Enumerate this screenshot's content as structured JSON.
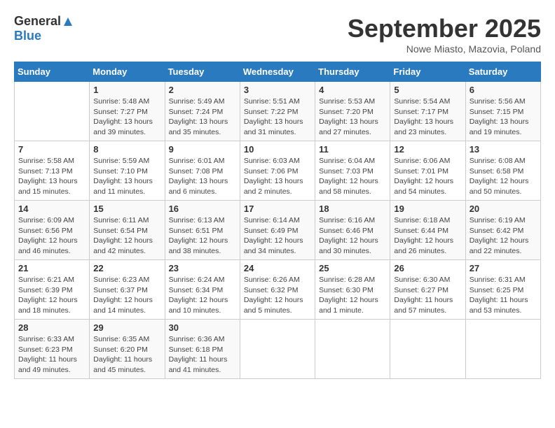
{
  "header": {
    "logo_line1": "General",
    "logo_line2": "Blue",
    "month_title": "September 2025",
    "location": "Nowe Miasto, Mazovia, Poland"
  },
  "weekdays": [
    "Sunday",
    "Monday",
    "Tuesday",
    "Wednesday",
    "Thursday",
    "Friday",
    "Saturday"
  ],
  "weeks": [
    [
      {
        "day": "",
        "info": ""
      },
      {
        "day": "1",
        "info": "Sunrise: 5:48 AM\nSunset: 7:27 PM\nDaylight: 13 hours\nand 39 minutes."
      },
      {
        "day": "2",
        "info": "Sunrise: 5:49 AM\nSunset: 7:24 PM\nDaylight: 13 hours\nand 35 minutes."
      },
      {
        "day": "3",
        "info": "Sunrise: 5:51 AM\nSunset: 7:22 PM\nDaylight: 13 hours\nand 31 minutes."
      },
      {
        "day": "4",
        "info": "Sunrise: 5:53 AM\nSunset: 7:20 PM\nDaylight: 13 hours\nand 27 minutes."
      },
      {
        "day": "5",
        "info": "Sunrise: 5:54 AM\nSunset: 7:17 PM\nDaylight: 13 hours\nand 23 minutes."
      },
      {
        "day": "6",
        "info": "Sunrise: 5:56 AM\nSunset: 7:15 PM\nDaylight: 13 hours\nand 19 minutes."
      }
    ],
    [
      {
        "day": "7",
        "info": "Sunrise: 5:58 AM\nSunset: 7:13 PM\nDaylight: 13 hours\nand 15 minutes."
      },
      {
        "day": "8",
        "info": "Sunrise: 5:59 AM\nSunset: 7:10 PM\nDaylight: 13 hours\nand 11 minutes."
      },
      {
        "day": "9",
        "info": "Sunrise: 6:01 AM\nSunset: 7:08 PM\nDaylight: 13 hours\nand 6 minutes."
      },
      {
        "day": "10",
        "info": "Sunrise: 6:03 AM\nSunset: 7:06 PM\nDaylight: 13 hours\nand 2 minutes."
      },
      {
        "day": "11",
        "info": "Sunrise: 6:04 AM\nSunset: 7:03 PM\nDaylight: 12 hours\nand 58 minutes."
      },
      {
        "day": "12",
        "info": "Sunrise: 6:06 AM\nSunset: 7:01 PM\nDaylight: 12 hours\nand 54 minutes."
      },
      {
        "day": "13",
        "info": "Sunrise: 6:08 AM\nSunset: 6:58 PM\nDaylight: 12 hours\nand 50 minutes."
      }
    ],
    [
      {
        "day": "14",
        "info": "Sunrise: 6:09 AM\nSunset: 6:56 PM\nDaylight: 12 hours\nand 46 minutes."
      },
      {
        "day": "15",
        "info": "Sunrise: 6:11 AM\nSunset: 6:54 PM\nDaylight: 12 hours\nand 42 minutes."
      },
      {
        "day": "16",
        "info": "Sunrise: 6:13 AM\nSunset: 6:51 PM\nDaylight: 12 hours\nand 38 minutes."
      },
      {
        "day": "17",
        "info": "Sunrise: 6:14 AM\nSunset: 6:49 PM\nDaylight: 12 hours\nand 34 minutes."
      },
      {
        "day": "18",
        "info": "Sunrise: 6:16 AM\nSunset: 6:46 PM\nDaylight: 12 hours\nand 30 minutes."
      },
      {
        "day": "19",
        "info": "Sunrise: 6:18 AM\nSunset: 6:44 PM\nDaylight: 12 hours\nand 26 minutes."
      },
      {
        "day": "20",
        "info": "Sunrise: 6:19 AM\nSunset: 6:42 PM\nDaylight: 12 hours\nand 22 minutes."
      }
    ],
    [
      {
        "day": "21",
        "info": "Sunrise: 6:21 AM\nSunset: 6:39 PM\nDaylight: 12 hours\nand 18 minutes."
      },
      {
        "day": "22",
        "info": "Sunrise: 6:23 AM\nSunset: 6:37 PM\nDaylight: 12 hours\nand 14 minutes."
      },
      {
        "day": "23",
        "info": "Sunrise: 6:24 AM\nSunset: 6:34 PM\nDaylight: 12 hours\nand 10 minutes."
      },
      {
        "day": "24",
        "info": "Sunrise: 6:26 AM\nSunset: 6:32 PM\nDaylight: 12 hours\nand 5 minutes."
      },
      {
        "day": "25",
        "info": "Sunrise: 6:28 AM\nSunset: 6:30 PM\nDaylight: 12 hours\nand 1 minute."
      },
      {
        "day": "26",
        "info": "Sunrise: 6:30 AM\nSunset: 6:27 PM\nDaylight: 11 hours\nand 57 minutes."
      },
      {
        "day": "27",
        "info": "Sunrise: 6:31 AM\nSunset: 6:25 PM\nDaylight: 11 hours\nand 53 minutes."
      }
    ],
    [
      {
        "day": "28",
        "info": "Sunrise: 6:33 AM\nSunset: 6:23 PM\nDaylight: 11 hours\nand 49 minutes."
      },
      {
        "day": "29",
        "info": "Sunrise: 6:35 AM\nSunset: 6:20 PM\nDaylight: 11 hours\nand 45 minutes."
      },
      {
        "day": "30",
        "info": "Sunrise: 6:36 AM\nSunset: 6:18 PM\nDaylight: 11 hours\nand 41 minutes."
      },
      {
        "day": "",
        "info": ""
      },
      {
        "day": "",
        "info": ""
      },
      {
        "day": "",
        "info": ""
      },
      {
        "day": "",
        "info": ""
      }
    ]
  ]
}
